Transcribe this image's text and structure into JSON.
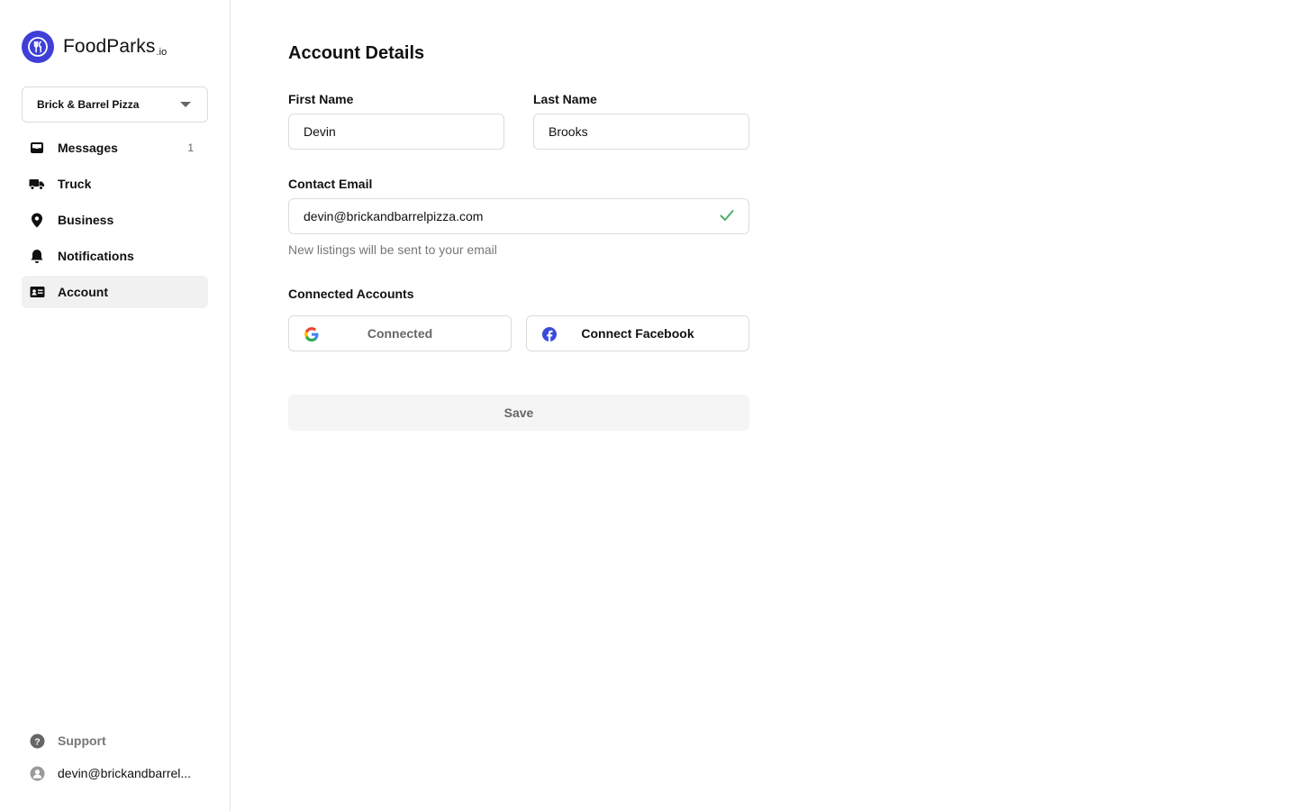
{
  "app": {
    "brand": "FoodParks",
    "brand_tld": ".io"
  },
  "sidebar": {
    "business_select": {
      "value": "Brick & Barrel Pizza"
    },
    "items": [
      {
        "label": "Messages",
        "icon": "inbox-icon",
        "count": "1"
      },
      {
        "label": "Truck",
        "icon": "truck-icon"
      },
      {
        "label": "Business",
        "icon": "map-pin-icon"
      },
      {
        "label": "Notifications",
        "icon": "bell-icon"
      },
      {
        "label": "Account",
        "icon": "id-card-icon",
        "active": true
      }
    ],
    "support_label": "Support",
    "user_email": "devin@brickandbarrel..."
  },
  "main": {
    "title": "Account Details",
    "first_name": {
      "label": "First Name",
      "value": "Devin"
    },
    "last_name": {
      "label": "Last Name",
      "value": "Brooks"
    },
    "email": {
      "label": "Contact Email",
      "value": "devin@brickandbarrelpizza.com",
      "helper": "New listings will be sent to your email",
      "verified_color": "#4caf6a"
    },
    "connected_accounts": {
      "label": "Connected Accounts",
      "google_label": "Connected",
      "facebook_label": "Connect Facebook"
    },
    "save_label": "Save"
  },
  "colors": {
    "brand": "#3f3fd8",
    "active_bg": "#f1f1f1",
    "facebook": "#3b4bd8"
  }
}
